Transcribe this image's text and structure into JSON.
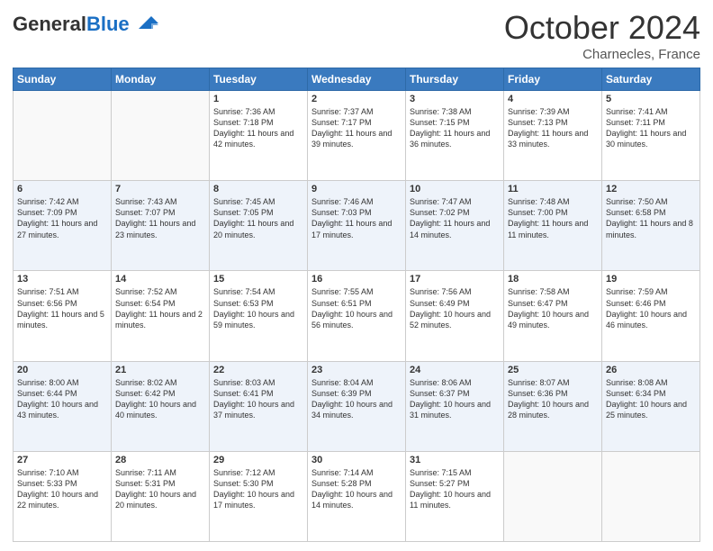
{
  "header": {
    "logo_general": "General",
    "logo_blue": "Blue",
    "month_title": "October 2024",
    "location": "Charnecles, France"
  },
  "days_of_week": [
    "Sunday",
    "Monday",
    "Tuesday",
    "Wednesday",
    "Thursday",
    "Friday",
    "Saturday"
  ],
  "weeks": [
    [
      {
        "day": "",
        "sunrise": "",
        "sunset": "",
        "daylight": ""
      },
      {
        "day": "",
        "sunrise": "",
        "sunset": "",
        "daylight": ""
      },
      {
        "day": "1",
        "sunrise": "Sunrise: 7:36 AM",
        "sunset": "Sunset: 7:18 PM",
        "daylight": "Daylight: 11 hours and 42 minutes."
      },
      {
        "day": "2",
        "sunrise": "Sunrise: 7:37 AM",
        "sunset": "Sunset: 7:17 PM",
        "daylight": "Daylight: 11 hours and 39 minutes."
      },
      {
        "day": "3",
        "sunrise": "Sunrise: 7:38 AM",
        "sunset": "Sunset: 7:15 PM",
        "daylight": "Daylight: 11 hours and 36 minutes."
      },
      {
        "day": "4",
        "sunrise": "Sunrise: 7:39 AM",
        "sunset": "Sunset: 7:13 PM",
        "daylight": "Daylight: 11 hours and 33 minutes."
      },
      {
        "day": "5",
        "sunrise": "Sunrise: 7:41 AM",
        "sunset": "Sunset: 7:11 PM",
        "daylight": "Daylight: 11 hours and 30 minutes."
      }
    ],
    [
      {
        "day": "6",
        "sunrise": "Sunrise: 7:42 AM",
        "sunset": "Sunset: 7:09 PM",
        "daylight": "Daylight: 11 hours and 27 minutes."
      },
      {
        "day": "7",
        "sunrise": "Sunrise: 7:43 AM",
        "sunset": "Sunset: 7:07 PM",
        "daylight": "Daylight: 11 hours and 23 minutes."
      },
      {
        "day": "8",
        "sunrise": "Sunrise: 7:45 AM",
        "sunset": "Sunset: 7:05 PM",
        "daylight": "Daylight: 11 hours and 20 minutes."
      },
      {
        "day": "9",
        "sunrise": "Sunrise: 7:46 AM",
        "sunset": "Sunset: 7:03 PM",
        "daylight": "Daylight: 11 hours and 17 minutes."
      },
      {
        "day": "10",
        "sunrise": "Sunrise: 7:47 AM",
        "sunset": "Sunset: 7:02 PM",
        "daylight": "Daylight: 11 hours and 14 minutes."
      },
      {
        "day": "11",
        "sunrise": "Sunrise: 7:48 AM",
        "sunset": "Sunset: 7:00 PM",
        "daylight": "Daylight: 11 hours and 11 minutes."
      },
      {
        "day": "12",
        "sunrise": "Sunrise: 7:50 AM",
        "sunset": "Sunset: 6:58 PM",
        "daylight": "Daylight: 11 hours and 8 minutes."
      }
    ],
    [
      {
        "day": "13",
        "sunrise": "Sunrise: 7:51 AM",
        "sunset": "Sunset: 6:56 PM",
        "daylight": "Daylight: 11 hours and 5 minutes."
      },
      {
        "day": "14",
        "sunrise": "Sunrise: 7:52 AM",
        "sunset": "Sunset: 6:54 PM",
        "daylight": "Daylight: 11 hours and 2 minutes."
      },
      {
        "day": "15",
        "sunrise": "Sunrise: 7:54 AM",
        "sunset": "Sunset: 6:53 PM",
        "daylight": "Daylight: 10 hours and 59 minutes."
      },
      {
        "day": "16",
        "sunrise": "Sunrise: 7:55 AM",
        "sunset": "Sunset: 6:51 PM",
        "daylight": "Daylight: 10 hours and 56 minutes."
      },
      {
        "day": "17",
        "sunrise": "Sunrise: 7:56 AM",
        "sunset": "Sunset: 6:49 PM",
        "daylight": "Daylight: 10 hours and 52 minutes."
      },
      {
        "day": "18",
        "sunrise": "Sunrise: 7:58 AM",
        "sunset": "Sunset: 6:47 PM",
        "daylight": "Daylight: 10 hours and 49 minutes."
      },
      {
        "day": "19",
        "sunrise": "Sunrise: 7:59 AM",
        "sunset": "Sunset: 6:46 PM",
        "daylight": "Daylight: 10 hours and 46 minutes."
      }
    ],
    [
      {
        "day": "20",
        "sunrise": "Sunrise: 8:00 AM",
        "sunset": "Sunset: 6:44 PM",
        "daylight": "Daylight: 10 hours and 43 minutes."
      },
      {
        "day": "21",
        "sunrise": "Sunrise: 8:02 AM",
        "sunset": "Sunset: 6:42 PM",
        "daylight": "Daylight: 10 hours and 40 minutes."
      },
      {
        "day": "22",
        "sunrise": "Sunrise: 8:03 AM",
        "sunset": "Sunset: 6:41 PM",
        "daylight": "Daylight: 10 hours and 37 minutes."
      },
      {
        "day": "23",
        "sunrise": "Sunrise: 8:04 AM",
        "sunset": "Sunset: 6:39 PM",
        "daylight": "Daylight: 10 hours and 34 minutes."
      },
      {
        "day": "24",
        "sunrise": "Sunrise: 8:06 AM",
        "sunset": "Sunset: 6:37 PM",
        "daylight": "Daylight: 10 hours and 31 minutes."
      },
      {
        "day": "25",
        "sunrise": "Sunrise: 8:07 AM",
        "sunset": "Sunset: 6:36 PM",
        "daylight": "Daylight: 10 hours and 28 minutes."
      },
      {
        "day": "26",
        "sunrise": "Sunrise: 8:08 AM",
        "sunset": "Sunset: 6:34 PM",
        "daylight": "Daylight: 10 hours and 25 minutes."
      }
    ],
    [
      {
        "day": "27",
        "sunrise": "Sunrise: 7:10 AM",
        "sunset": "Sunset: 5:33 PM",
        "daylight": "Daylight: 10 hours and 22 minutes."
      },
      {
        "day": "28",
        "sunrise": "Sunrise: 7:11 AM",
        "sunset": "Sunset: 5:31 PM",
        "daylight": "Daylight: 10 hours and 20 minutes."
      },
      {
        "day": "29",
        "sunrise": "Sunrise: 7:12 AM",
        "sunset": "Sunset: 5:30 PM",
        "daylight": "Daylight: 10 hours and 17 minutes."
      },
      {
        "day": "30",
        "sunrise": "Sunrise: 7:14 AM",
        "sunset": "Sunset: 5:28 PM",
        "daylight": "Daylight: 10 hours and 14 minutes."
      },
      {
        "day": "31",
        "sunrise": "Sunrise: 7:15 AM",
        "sunset": "Sunset: 5:27 PM",
        "daylight": "Daylight: 10 hours and 11 minutes."
      },
      {
        "day": "",
        "sunrise": "",
        "sunset": "",
        "daylight": ""
      },
      {
        "day": "",
        "sunrise": "",
        "sunset": "",
        "daylight": ""
      }
    ]
  ]
}
